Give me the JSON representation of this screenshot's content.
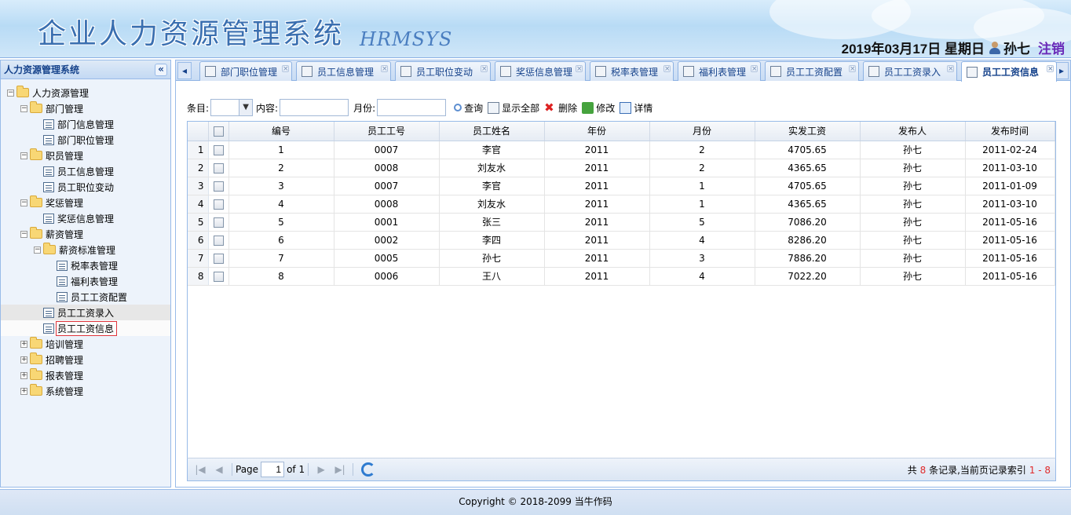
{
  "header": {
    "title": "企业人力资源管理系统",
    "subtitle": "HRMSYS",
    "date": "2019年03月17日 星期日",
    "user": "孙七",
    "logout": "注销"
  },
  "sidebar": {
    "title": "人力资源管理系统",
    "collapse_glyph": "«",
    "nodes": [
      {
        "label": "人力资源管理",
        "level": 0,
        "type": "folder",
        "expanded": true
      },
      {
        "label": "部门管理",
        "level": 1,
        "type": "folder",
        "expanded": true
      },
      {
        "label": "部门信息管理",
        "level": 2,
        "type": "file"
      },
      {
        "label": "部门职位管理",
        "level": 2,
        "type": "file"
      },
      {
        "label": "职员管理",
        "level": 1,
        "type": "folder",
        "expanded": true
      },
      {
        "label": "员工信息管理",
        "level": 2,
        "type": "file"
      },
      {
        "label": "员工职位变动",
        "level": 2,
        "type": "file"
      },
      {
        "label": "奖惩管理",
        "level": 1,
        "type": "folder",
        "expanded": true
      },
      {
        "label": "奖惩信息管理",
        "level": 2,
        "type": "file"
      },
      {
        "label": "薪资管理",
        "level": 1,
        "type": "folder",
        "expanded": true
      },
      {
        "label": "薪资标准管理",
        "level": 2,
        "type": "folder",
        "expanded": true
      },
      {
        "label": "税率表管理",
        "level": 3,
        "type": "file"
      },
      {
        "label": "福利表管理",
        "level": 3,
        "type": "file"
      },
      {
        "label": "员工工资配置",
        "level": 3,
        "type": "file"
      },
      {
        "label": "员工工资录入",
        "level": 2,
        "type": "file",
        "state": "hover"
      },
      {
        "label": "员工工资信息",
        "level": 2,
        "type": "file",
        "state": "selected"
      },
      {
        "label": "培训管理",
        "level": 1,
        "type": "folder",
        "expanded": false
      },
      {
        "label": "招聘管理",
        "level": 1,
        "type": "folder",
        "expanded": false
      },
      {
        "label": "报表管理",
        "level": 1,
        "type": "folder",
        "expanded": false
      },
      {
        "label": "系统管理",
        "level": 1,
        "type": "folder",
        "expanded": false
      }
    ]
  },
  "tabs": {
    "left_scroll": "◂",
    "right_scroll": "▸",
    "items": [
      {
        "label": "部门职位管理",
        "icon": "org-icon",
        "active": false
      },
      {
        "label": "员工信息管理",
        "icon": "user-icon",
        "active": false
      },
      {
        "label": "员工职位变动",
        "icon": "swap-icon",
        "active": false
      },
      {
        "label": "奖惩信息管理",
        "icon": "list-icon",
        "active": false
      },
      {
        "label": "税率表管理",
        "icon": "table-icon",
        "active": false
      },
      {
        "label": "福利表管理",
        "icon": "scroll-icon",
        "active": false
      },
      {
        "label": "员工工资配置",
        "icon": "money-icon",
        "active": false
      },
      {
        "label": "员工工资录入",
        "icon": "edit-icon",
        "active": false
      },
      {
        "label": "员工工资信息",
        "icon": "grid-icon",
        "active": true
      }
    ]
  },
  "toolbar": {
    "field_label": "条目:",
    "field_value": "",
    "content_label": "内容:",
    "content_value": "",
    "month_label": "月份:",
    "month_value": "",
    "query": "查询",
    "show_all": "显示全部",
    "delete": "删除",
    "modify": "修改",
    "detail": "详情"
  },
  "grid": {
    "columns": [
      "编号",
      "员工工号",
      "员工姓名",
      "年份",
      "月份",
      "实发工资",
      "发布人",
      "发布时间"
    ],
    "rows": [
      [
        "1",
        "0007",
        "李官",
        "2011",
        "2",
        "4705.65",
        "孙七",
        "2011-02-24"
      ],
      [
        "2",
        "0008",
        "刘友水",
        "2011",
        "2",
        "4365.65",
        "孙七",
        "2011-03-10"
      ],
      [
        "3",
        "0007",
        "李官",
        "2011",
        "1",
        "4705.65",
        "孙七",
        "2011-01-09"
      ],
      [
        "4",
        "0008",
        "刘友水",
        "2011",
        "1",
        "4365.65",
        "孙七",
        "2011-03-10"
      ],
      [
        "5",
        "0001",
        "张三",
        "2011",
        "5",
        "7086.20",
        "孙七",
        "2011-05-16"
      ],
      [
        "6",
        "0002",
        "李四",
        "2011",
        "4",
        "8286.20",
        "孙七",
        "2011-05-16"
      ],
      [
        "7",
        "0005",
        "孙七",
        "2011",
        "3",
        "7886.20",
        "孙七",
        "2011-05-16"
      ],
      [
        "8",
        "0006",
        "王八",
        "2011",
        "4",
        "7022.20",
        "孙七",
        "2011-05-16"
      ]
    ]
  },
  "pager": {
    "page_label": "Page",
    "page_value": "1",
    "of_label": "of 1",
    "info_prefix": "共",
    "total": "8",
    "info_middle": "条记录,当前页记录索引",
    "range": "1 - 8"
  },
  "footer": {
    "text": "Copyright © 2018-2099 当牛作码"
  }
}
